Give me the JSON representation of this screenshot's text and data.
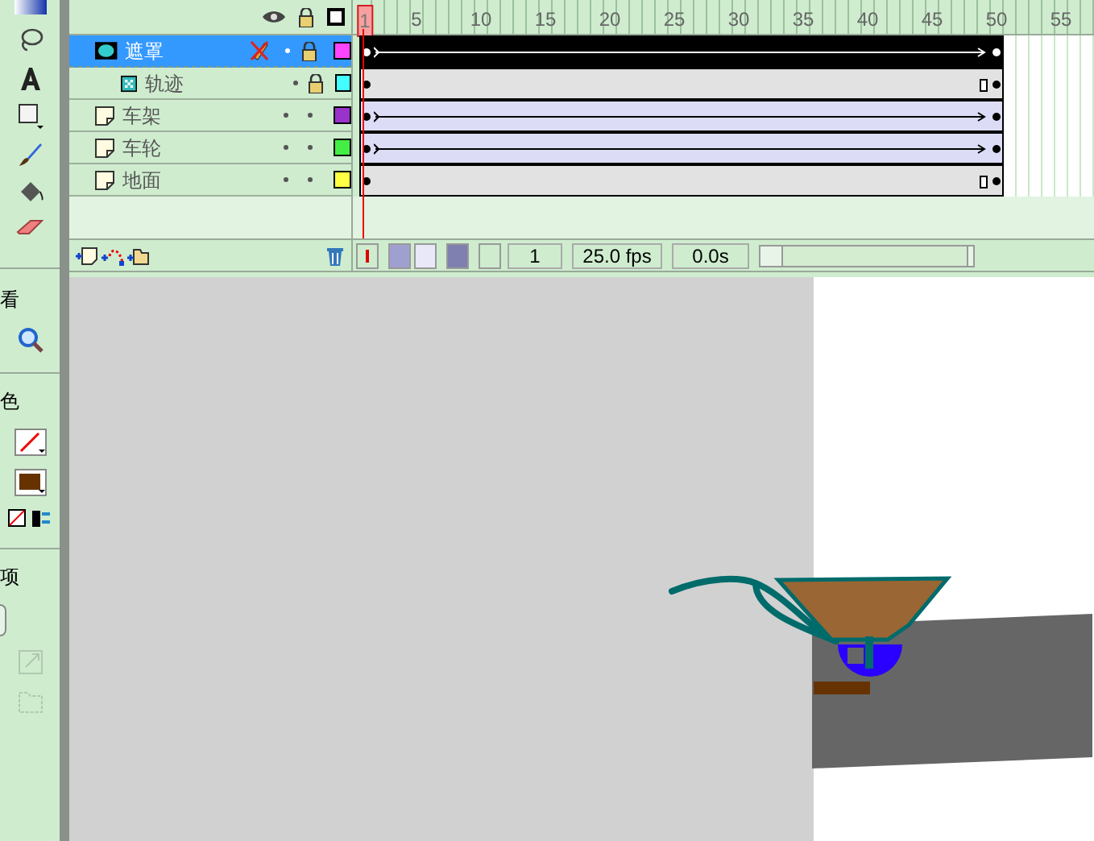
{
  "tools": {
    "section_labels": [
      "看",
      "色",
      "项"
    ]
  },
  "timeline": {
    "ruler": [
      "1",
      "5",
      "10",
      "15",
      "20",
      "25",
      "30",
      "35",
      "40",
      "45",
      "50",
      "55"
    ],
    "layers": [
      {
        "name": "遮罩",
        "kind": "mask",
        "selected": true,
        "locked": true,
        "color": "#ff44ff",
        "tween": {
          "kind": "motion"
        },
        "children": [
          {
            "name": "轨迹",
            "kind": "guide",
            "selected": false,
            "locked": true,
            "color": "#44ffff",
            "tween": {
              "kind": "static"
            }
          }
        ]
      },
      {
        "name": "车架",
        "kind": "normal",
        "selected": false,
        "locked": false,
        "color": "#9933cc",
        "tween": {
          "kind": "motion"
        }
      },
      {
        "name": "车轮",
        "kind": "normal",
        "selected": false,
        "locked": false,
        "color": "#44ee44",
        "tween": {
          "kind": "motion"
        }
      },
      {
        "name": "地面",
        "kind": "normal",
        "selected": false,
        "locked": false,
        "color": "#ffff44",
        "tween": {
          "kind": "static"
        }
      }
    ],
    "current_frame": "1",
    "frame_rate": "25.0 fps",
    "elapsed": "0.0s"
  }
}
